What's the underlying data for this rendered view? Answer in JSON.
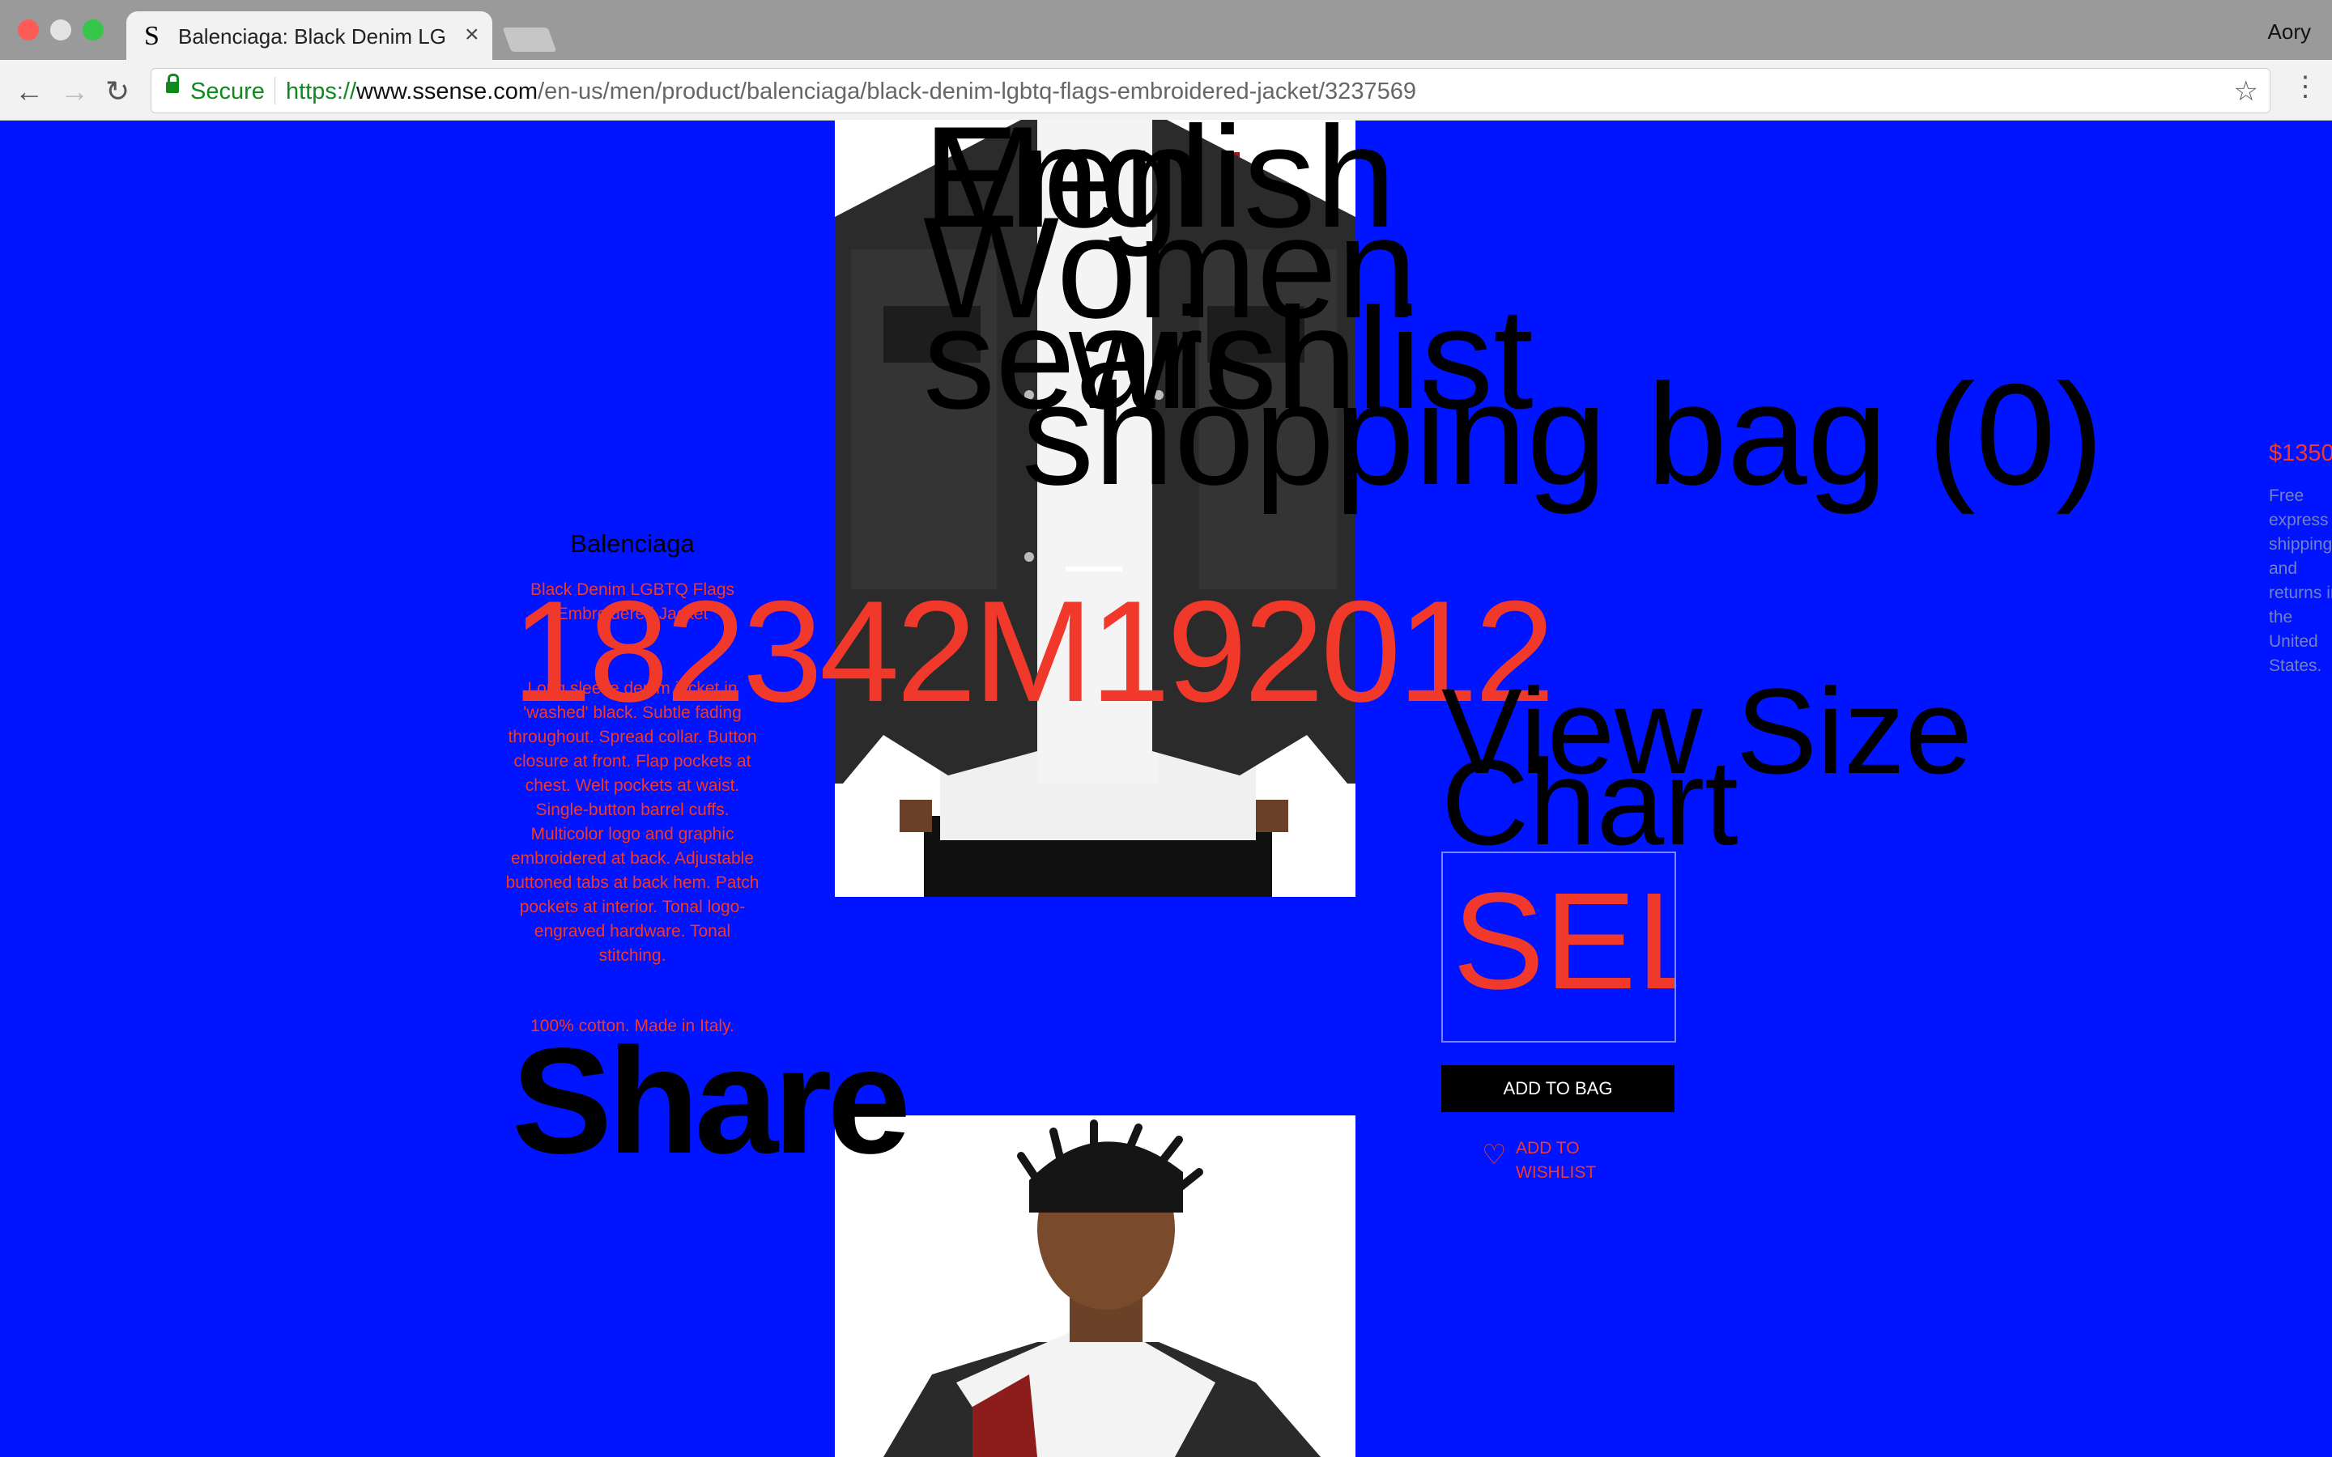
{
  "browser": {
    "tab_favicon": "S",
    "tab_title": "Balenciaga: Black Denim LGBTQ Flags Embroidered Jacket | SSENSE",
    "tab_close": "×",
    "profile": "Aory",
    "secure_label": "Secure",
    "url_proto": "https://",
    "url_host": "www.ssense.com",
    "url_path": "/en-us/men/product/balenciaga/black-denim-lgbtq-flags-embroidered-jacket/3237569",
    "icons": [
      "back-arrow-icon",
      "forward-arrow-icon",
      "reload-icon",
      "lock-icon",
      "star-icon",
      "menu-icon"
    ]
  },
  "nav": {
    "language": "English",
    "men": "Men",
    "women": "Women",
    "search": "search",
    "wishlist": "wishlist",
    "shopping_bag": "shopping bag (0)"
  },
  "product": {
    "brand": "Balenciaga",
    "name": "Black Denim LGBTQ Flags Embroidered Jacket",
    "description": "Long sleeve denim jacket in 'washed' black. Subtle fading throughout. Spread collar. Button closure at front. Flap pockets at chest. Welt pockets at waist. Single-button barrel cuffs. Multicolor logo and graphic embroidered at back. Adjustable buttoned tabs at back hem. Patch pockets at interior. Tonal logo-engraved hardware. Tonal stitching.",
    "composition": "100% cotton. Made in Italy.",
    "product_number": "182342M192012",
    "share": "Share",
    "price": "$1350",
    "shipping": "Free express shipping and returns in the United States."
  },
  "purchase": {
    "view_size": "View Size",
    "chart": "Chart",
    "size_select": "SELECT A SIZE",
    "add_to_bag": "ADD TO BAG",
    "add_to_wishlist": "ADD TO WISHLIST"
  },
  "colors": {
    "page_bg": "#0014ff",
    "accent_red": "#f0392a",
    "text_black": "#000000"
  }
}
